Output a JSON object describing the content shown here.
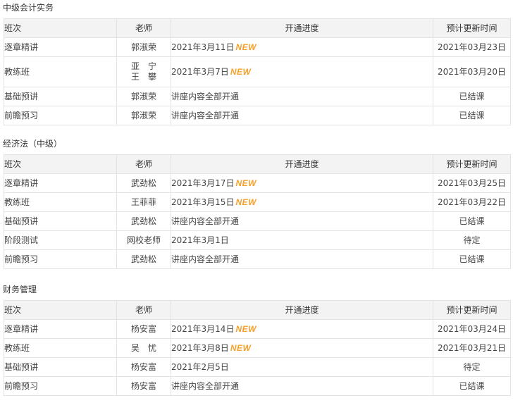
{
  "headers": {
    "class": "班次",
    "teacher": "老师",
    "progress": "开通进度",
    "update": "预计更新时间"
  },
  "new_badge": "NEW",
  "colors": {
    "badge": "#f7a02a",
    "header_bg": "#f3f3f3",
    "border": "#e3e3e3"
  },
  "sections": [
    {
      "title": "中级会计实务",
      "rows": [
        {
          "class": "逐章精讲",
          "teacher": [
            "郭淑荣"
          ],
          "progress": "2021年3月11日",
          "is_new": true,
          "update": "2021年03月23日"
        },
        {
          "class": "教练班",
          "teacher": [
            "亚　宁",
            "王　攀"
          ],
          "progress": "2021年3月7日",
          "is_new": true,
          "update": "2021年03月20日"
        },
        {
          "class": "基础预讲",
          "teacher": [
            "郭淑荣"
          ],
          "progress": "讲座内容全部开通",
          "is_new": false,
          "update": "已结课"
        },
        {
          "class": "前瞻预习",
          "teacher": [
            "郭淑荣"
          ],
          "progress": "讲座内容全部开通",
          "is_new": false,
          "update": "已结课"
        }
      ]
    },
    {
      "title": "经济法（中级）",
      "rows": [
        {
          "class": "逐章精讲",
          "teacher": [
            "武劲松"
          ],
          "progress": "2021年3月17日",
          "is_new": true,
          "update": "2021年03月25日"
        },
        {
          "class": "教练班",
          "teacher": [
            "王菲菲"
          ],
          "progress": "2021年3月15日",
          "is_new": true,
          "update": "2021年03月22日"
        },
        {
          "class": "基础预讲",
          "teacher": [
            "武劲松"
          ],
          "progress": "讲座内容全部开通",
          "is_new": false,
          "update": "已结课"
        },
        {
          "class": "阶段测试",
          "teacher": [
            "网校老师"
          ],
          "progress": "2021年3月1日",
          "is_new": false,
          "update": "待定"
        },
        {
          "class": "前瞻预习",
          "teacher": [
            "武劲松"
          ],
          "progress": "讲座内容全部开通",
          "is_new": false,
          "update": "已结课"
        }
      ]
    },
    {
      "title": "财务管理",
      "rows": [
        {
          "class": "逐章精讲",
          "teacher": [
            "杨安富"
          ],
          "progress": "2021年3月14日",
          "is_new": true,
          "update": "2021年03月24日"
        },
        {
          "class": "教练班",
          "teacher": [
            "吴　忧"
          ],
          "progress": "2021年3月8日",
          "is_new": true,
          "update": "2021年03月21日"
        },
        {
          "class": "基础预讲",
          "teacher": [
            "杨安富"
          ],
          "progress": "2021年2月5日",
          "is_new": false,
          "update": "待定"
        },
        {
          "class": "前瞻预习",
          "teacher": [
            "杨安富"
          ],
          "progress": "讲座内容全部开通",
          "is_new": false,
          "update": "已结课"
        }
      ]
    }
  ]
}
